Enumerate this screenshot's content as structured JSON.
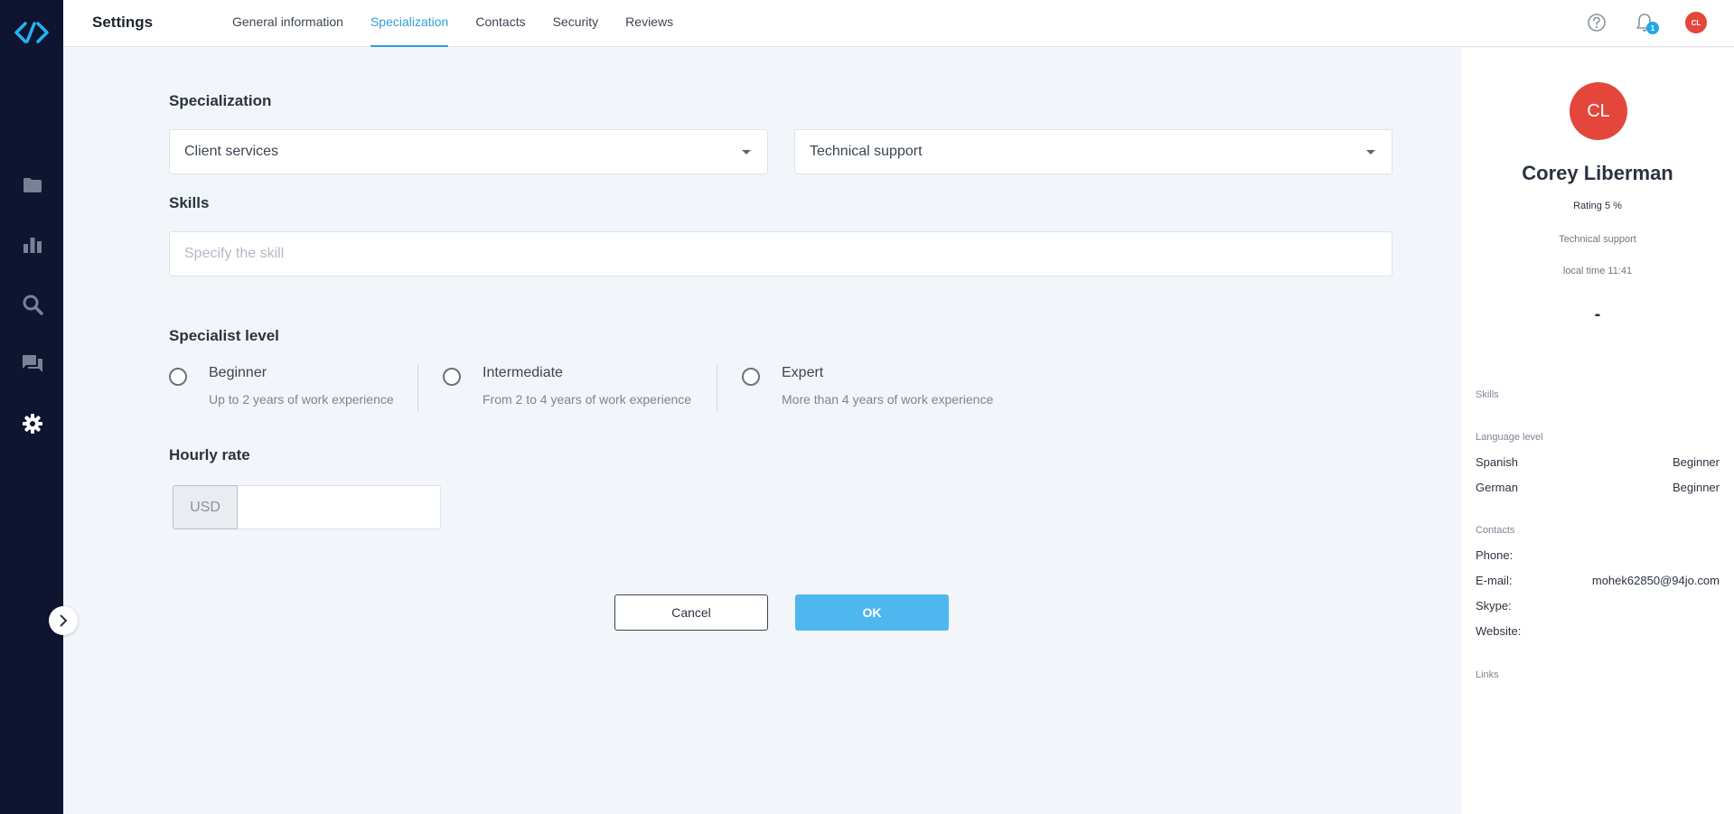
{
  "header": {
    "title": "Settings",
    "tabs": [
      "General information",
      "Specialization",
      "Contacts",
      "Security",
      "Reviews"
    ],
    "active_tab": "Specialization",
    "notification_count": "1",
    "avatar_initials": "CL"
  },
  "sidebar": {
    "icons": [
      "folder-icon",
      "bar-chart-icon",
      "search-icon",
      "chat-icon",
      "gear-icon"
    ],
    "active": "gear-icon"
  },
  "specialization": {
    "title": "Specialization",
    "primary": "Client services",
    "secondary": "Technical support"
  },
  "skills": {
    "title": "Skills",
    "placeholder": "Specify the skill"
  },
  "level": {
    "title": "Specialist level",
    "options": [
      {
        "name": "Beginner",
        "desc": "Up to 2 years of work experience"
      },
      {
        "name": "Intermediate",
        "desc": "From 2 to 4 years of work experience"
      },
      {
        "name": "Expert",
        "desc": "More than 4 years of work experience"
      }
    ]
  },
  "rate": {
    "title": "Hourly rate",
    "currency": "USD",
    "value": ""
  },
  "actions": {
    "cancel": "Cancel",
    "ok": "OK"
  },
  "profile": {
    "initials": "CL",
    "name": "Corey Liberman",
    "rating": "Rating 5 %",
    "specialization": "Technical support",
    "local_time": "local time 11:41",
    "dash": "-",
    "skills_label": "Skills",
    "language_label": "Language level",
    "languages": [
      {
        "lang": "Spanish",
        "level": "Beginner"
      },
      {
        "lang": "German",
        "level": "Beginner"
      }
    ],
    "contacts_label": "Contacts",
    "contacts": [
      {
        "label": "Phone:",
        "value": ""
      },
      {
        "label": "E-mail:",
        "value": "mohek62850@94jo.com"
      },
      {
        "label": "Skype:",
        "value": ""
      },
      {
        "label": "Website:",
        "value": ""
      }
    ],
    "links_label": "Links"
  },
  "colors": {
    "accent": "#2f9fd8",
    "ok_button": "#4eb7f0",
    "avatar": "#e4463b",
    "sidebar": "#0f1430"
  }
}
